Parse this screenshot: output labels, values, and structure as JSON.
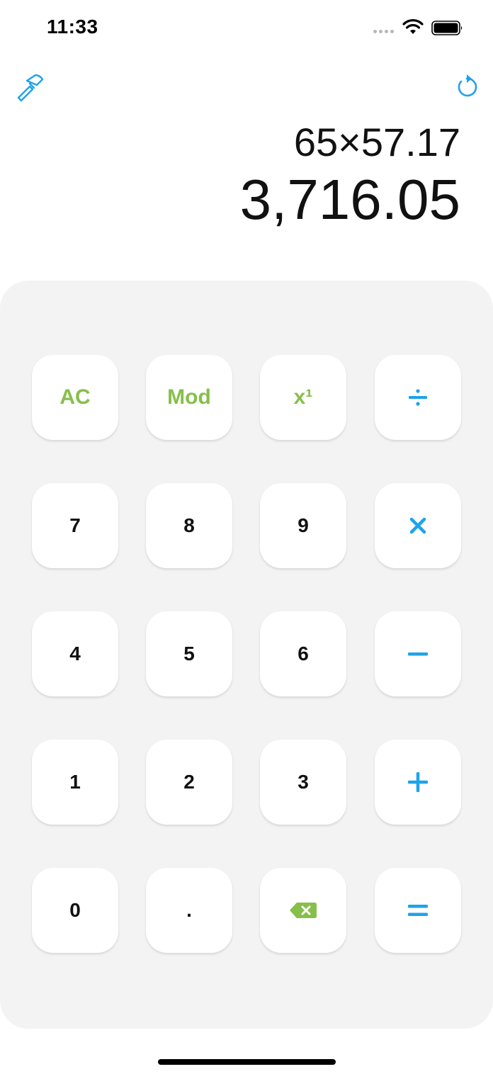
{
  "status_bar": {
    "time": "11:33"
  },
  "display": {
    "expression": "65×57.17",
    "result": "3,716.05"
  },
  "keypad": {
    "row1": {
      "ac": "AC",
      "mod": "Mod",
      "power": "x¹"
    },
    "row2": {
      "seven": "7",
      "eight": "8",
      "nine": "9"
    },
    "row3": {
      "four": "4",
      "five": "5",
      "six": "6"
    },
    "row4": {
      "one": "1",
      "two": "2",
      "three": "3"
    },
    "row5": {
      "zero": "0",
      "decimal": "."
    }
  },
  "icons": {
    "top_left": "hammer-icon",
    "top_right": "history-icon",
    "divide": "divide-icon",
    "multiply": "multiply-icon",
    "minus": "minus-icon",
    "plus": "plus-icon",
    "backspace": "backspace-icon",
    "equals": "equals-icon"
  },
  "colors": {
    "function_green": "#86bf4a",
    "operator_blue": "#1ea3ea",
    "keypad_background": "#f3f3f3"
  }
}
